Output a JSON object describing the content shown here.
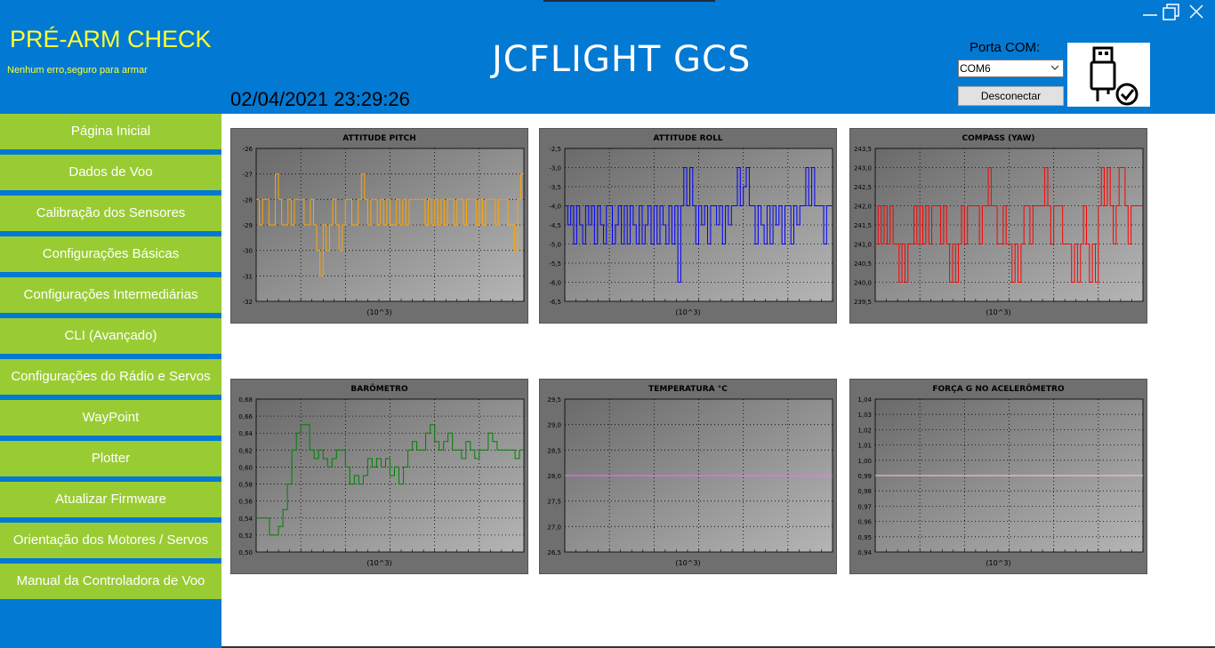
{
  "header": {
    "prearm_title": "PRÉ-ARM CHECK",
    "prearm_status": "Nenhum erro,seguro para armar",
    "app_title": "JCFLIGHT GCS",
    "datetime": "02/04/2021 23:29:26",
    "com_label": "Porta COM:",
    "com_value": "COM6",
    "disconnect_label": "Desconectar",
    "colors": {
      "header_bg": "#0279d3",
      "prearm": "#ffff33",
      "nav_bg": "#99cc33"
    }
  },
  "window_controls": {
    "minimize": "minimize-icon",
    "restore": "restore-icon",
    "close": "close-icon"
  },
  "sidebar": {
    "items": [
      {
        "label": "Página Inicial"
      },
      {
        "label": "Dados de Voo"
      },
      {
        "label": "Calibração dos Sensores"
      },
      {
        "label": "Configurações Básicas"
      },
      {
        "label": "Configurações Intermediárias"
      },
      {
        "label": "CLI (Avançado)"
      },
      {
        "label": "Configurações do Rádio e Servos"
      },
      {
        "label": "WayPoint"
      },
      {
        "label": "Plotter"
      },
      {
        "label": "Atualizar Firmware"
      },
      {
        "label": "Orientação dos Motores / Servos"
      },
      {
        "label": "Manual da Controladora de Voo"
      }
    ]
  },
  "chart_data": [
    {
      "type": "line",
      "title": "ATTITUDE PITCH",
      "xlabel": "(10^3)",
      "color": "#ffa500",
      "ylim": [
        -32,
        -26
      ],
      "yticks": [
        "-26",
        "-27",
        "-28",
        "-29",
        "-30",
        "-31",
        "-32"
      ],
      "series": [
        {
          "values": [
            -28,
            -29,
            -28,
            -28,
            -29,
            -29,
            -27,
            -28,
            -29,
            -29,
            -28,
            -29,
            -28,
            -28,
            -28,
            -29,
            -29,
            -28,
            -29,
            -30,
            -31,
            -29,
            -30,
            -29,
            -28,
            -29,
            -30,
            -29,
            -28,
            -28,
            -29,
            -29,
            -28,
            -27,
            -28,
            -29,
            -28,
            -28,
            -29,
            -28,
            -29,
            -28,
            -29,
            -29,
            -28,
            -29,
            -28,
            -29,
            -28,
            -28,
            -28,
            -28,
            -28,
            -29,
            -28,
            -29,
            -28,
            -29,
            -28,
            -29,
            -28,
            -28,
            -29,
            -28,
            -28,
            -29,
            -28,
            -28,
            -28,
            -29,
            -28,
            -29,
            -28,
            -28,
            -28,
            -29,
            -28,
            -28,
            -28,
            -29,
            -29,
            -30,
            -28,
            -27
          ]
        }
      ]
    },
    {
      "type": "line",
      "title": "ATTITUDE ROLL",
      "xlabel": "(10^3)",
      "color": "#0000ff",
      "ylim": [
        -6.5,
        -2.5
      ],
      "yticks": [
        "-2,5",
        "-3,0",
        "-3,5",
        "-4,0",
        "-4,5",
        "-5,0",
        "-5,5",
        "-6,0",
        "-6,5"
      ],
      "series": [
        {
          "values": [
            -4,
            -4.5,
            -4,
            -5,
            -4,
            -4.5,
            -5,
            -4,
            -4.5,
            -4,
            -5,
            -4,
            -4.5,
            -5,
            -4,
            -4,
            -5,
            -4.5,
            -4,
            -5,
            -4,
            -5,
            -4,
            -4.5,
            -5,
            -4,
            -5,
            -4.5,
            -4,
            -5,
            -4,
            -5,
            -4,
            -4.5,
            -5,
            -4,
            -5,
            -4,
            -6,
            -4,
            -3,
            -4,
            -3,
            -4,
            -5,
            -4,
            -4.5,
            -4,
            -5,
            -4,
            -4,
            -4.5,
            -4,
            -5,
            -4,
            -4.5,
            -4,
            -4,
            -3,
            -4,
            -3.5,
            -3,
            -4,
            -4,
            -5,
            -4,
            -4.5,
            -5,
            -4,
            -5,
            -4,
            -4.5,
            -4,
            -5,
            -4,
            -4,
            -5,
            -4,
            -4.5,
            -4,
            -4,
            -3,
            -4,
            -3,
            -4,
            -4,
            -4,
            -5,
            -4,
            -4
          ]
        }
      ]
    },
    {
      "type": "line",
      "title": "COMPASS (YAW)",
      "xlabel": "(10^3)",
      "color": "#ff0000",
      "ylim": [
        239.5,
        243.5
      ],
      "yticks": [
        "243,5",
        "243,0",
        "242,5",
        "242,0",
        "241,5",
        "241,0",
        "240,5",
        "240,0",
        "239,5"
      ],
      "series": [
        {
          "values": [
            241,
            242,
            241,
            242,
            241,
            242,
            241,
            241,
            240,
            241,
            240,
            241,
            241,
            242,
            241,
            242,
            241,
            242,
            241,
            242,
            242,
            242,
            241,
            242,
            241,
            240,
            241,
            240,
            241,
            242,
            241,
            242,
            242,
            242,
            242,
            241,
            242,
            242,
            243,
            242,
            242,
            241,
            241,
            242,
            241,
            241,
            240,
            241,
            240,
            241,
            242,
            242,
            241,
            242,
            242,
            242,
            242,
            243,
            242,
            241,
            242,
            242,
            242,
            241,
            241,
            241,
            240,
            241,
            240,
            241,
            242,
            241,
            240,
            241,
            240,
            242,
            243,
            242,
            243,
            242,
            241,
            242,
            243,
            243,
            242,
            241,
            242,
            242,
            242,
            242
          ]
        }
      ]
    },
    {
      "type": "line",
      "title": "BARÔMETRO",
      "xlabel": "(10^3)",
      "color": "#008000",
      "ylim": [
        0.5,
        0.68
      ],
      "yticks": [
        "0,68",
        "0,66",
        "0,64",
        "0,62",
        "0,60",
        "0,58",
        "0,56",
        "0,54",
        "0,52",
        "0,50"
      ],
      "series": [
        {
          "values": [
            0.54,
            0.54,
            0.54,
            0.52,
            0.52,
            0.53,
            0.55,
            0.58,
            0.62,
            0.64,
            0.65,
            0.65,
            0.62,
            0.61,
            0.62,
            0.61,
            0.6,
            0.61,
            0.62,
            0.62,
            0.6,
            0.58,
            0.59,
            0.58,
            0.59,
            0.61,
            0.6,
            0.61,
            0.6,
            0.61,
            0.59,
            0.6,
            0.58,
            0.6,
            0.62,
            0.63,
            0.62,
            0.62,
            0.64,
            0.65,
            0.63,
            0.62,
            0.63,
            0.64,
            0.62,
            0.62,
            0.61,
            0.63,
            0.62,
            0.61,
            0.62,
            0.62,
            0.64,
            0.63,
            0.62,
            0.62,
            0.62,
            0.62,
            0.61,
            0.62
          ]
        }
      ]
    },
    {
      "type": "line",
      "title": "TEMPERATURA °C",
      "xlabel": "(10^3)",
      "color": "#ff66ff",
      "ylim": [
        26.5,
        29.5
      ],
      "yticks": [
        "29,5",
        "29,0",
        "28,5",
        "28,0",
        "27,5",
        "27,0",
        "26,5"
      ],
      "series": [
        {
          "values": [
            28,
            28,
            28,
            28,
            28,
            28,
            28,
            28,
            28,
            28
          ]
        }
      ]
    },
    {
      "type": "line",
      "title": "FORÇA G NO ACELERÔMETRO",
      "xlabel": "(10^3)",
      "color": "#ffcccc",
      "ylim": [
        0.94,
        1.04
      ],
      "yticks": [
        "1,04",
        "1,03",
        "1,02",
        "1,01",
        "1,00",
        "0,99",
        "0,98",
        "0,97",
        "0,96",
        "0,95",
        "0,94"
      ],
      "series": [
        {
          "values": [
            0.99,
            0.99,
            0.99,
            0.99,
            0.99,
            0.99,
            0.99,
            0.99,
            0.99,
            0.99
          ]
        }
      ]
    }
  ]
}
